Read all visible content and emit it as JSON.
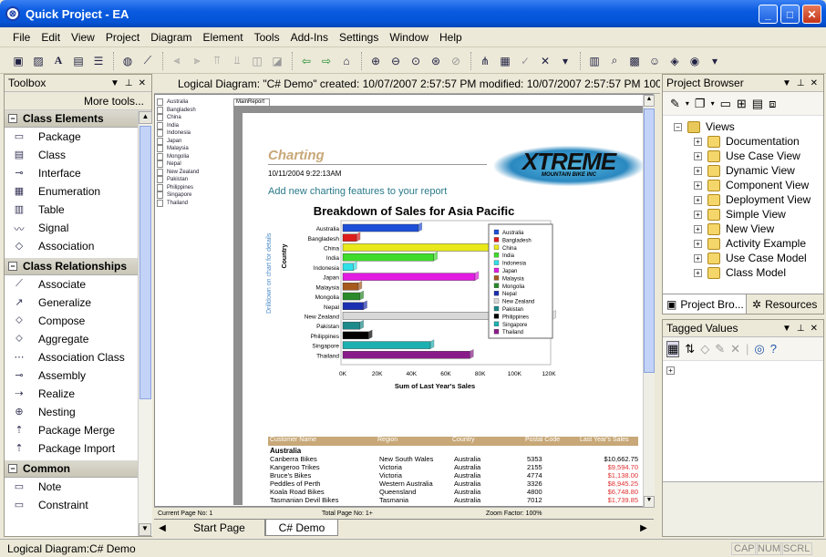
{
  "window": {
    "title": "Quick Project - EA"
  },
  "menu": [
    "File",
    "Edit",
    "View",
    "Project",
    "Diagram",
    "Element",
    "Tools",
    "Add-Ins",
    "Settings",
    "Window",
    "Help"
  ],
  "toolbox": {
    "title": "Toolbox",
    "more": "More tools...",
    "cat1": "Class Elements",
    "items1": [
      "Package",
      "Class",
      "Interface",
      "Enumeration",
      "Table",
      "Signal",
      "Association"
    ],
    "cat2": "Class Relationships",
    "items2": [
      "Associate",
      "Generalize",
      "Compose",
      "Aggregate",
      "Association Class",
      "Assembly",
      "Realize",
      "Nesting",
      "Package Merge",
      "Package Import"
    ],
    "cat3": "Common",
    "items3": [
      "Note",
      "Constraint"
    ]
  },
  "diagram": {
    "header": "Logical Diagram: \"C# Demo\"   created: 10/07/2007 2:57:57 PM  modified: 10/07/2007 2:57:57 PM   100"
  },
  "report": {
    "tab": "MainReport",
    "outline": [
      "Australia",
      "Bangladesh",
      "China",
      "India",
      "Indonesia",
      "Japan",
      "Malaysia",
      "Mongolia",
      "Nepal",
      "New Zealand",
      "Pakistan",
      "Philippines",
      "Singapore",
      "Thailand"
    ],
    "heading": "Charting",
    "datetime": "10/11/2004   9:22:13AM",
    "subheading": "Add new charting features to your report",
    "logo_main": "XTREME",
    "logo_sub": "MOUNTAIN BIKE INC",
    "side_label": "Drilldown on chart for details",
    "table_headers": [
      "Customer Name",
      "Region",
      "Country",
      "Postal Code",
      "Last Year's Sales"
    ],
    "group": "Australia",
    "rows": [
      [
        "Canberra Bikes",
        "New South Wales",
        "Australia",
        "5353",
        "$10,662.75"
      ],
      [
        "Kangeroo Trikes",
        "Victoria",
        "Australia",
        "2155",
        "$9,594.70"
      ],
      [
        "Bruce's Bikes",
        "Victoria",
        "Australia",
        "4774",
        "$1,138.00"
      ],
      [
        "Peddles of Perth",
        "Western Australia",
        "Australia",
        "3326",
        "$8,945.25"
      ],
      [
        "Koala Road Bikes",
        "Queensland",
        "Australia",
        "4800",
        "$6,748.80"
      ],
      [
        "Tasmanian Devil Bikes",
        "Tasmania",
        "Australia",
        "7012",
        "$1,739.85"
      ]
    ],
    "row_colors": [
      "#000000",
      "#e03030",
      "#e03030",
      "#e03030",
      "#e03030",
      "#e03030"
    ],
    "status": {
      "page": "Current Page No: 1",
      "total": "Total Page No: 1+",
      "zoom": "Zoom Factor: 100%"
    }
  },
  "chart_data": {
    "type": "bar",
    "orientation": "horizontal",
    "title": "Breakdown of Sales for Asia Pacific",
    "xlabel": "Sum of Last Year's Sales",
    "ylabel": "Country",
    "categories": [
      "Australia",
      "Bangladesh",
      "China",
      "India",
      "Indonesia",
      "Japan",
      "Malaysia",
      "Mongolia",
      "Nepal",
      "New Zealand",
      "Pakistan",
      "Philippines",
      "Singapore",
      "Thailand"
    ],
    "values": [
      44000,
      8000,
      90000,
      53000,
      6000,
      77000,
      9000,
      10000,
      12000,
      122000,
      10000,
      15000,
      51000,
      74000
    ],
    "colors": [
      "#1d4fd8",
      "#dd1c1c",
      "#e8e81a",
      "#3fdc2c",
      "#30e0e6",
      "#e21ce0",
      "#a65a1c",
      "#2a8a2a",
      "#1c2fb0",
      "#d8d8d8",
      "#1c8a8a",
      "#000000",
      "#1cb0b0",
      "#8a1c8a"
    ],
    "xticks": [
      "0K",
      "20K",
      "40K",
      "60K",
      "80K",
      "100K",
      "120K"
    ],
    "xlim": [
      0,
      120000
    ],
    "legend": "right",
    "grid": false
  },
  "tabs": {
    "start": "Start Page",
    "demo": "C# Demo"
  },
  "browser": {
    "title": "Project Browser",
    "root": "Views",
    "items": [
      "Documentation",
      "Use Case View",
      "Dynamic View",
      "Component View",
      "Deployment View",
      "Simple View",
      "New View",
      "Activity Example",
      "Use Case Model",
      "Class Model"
    ],
    "tab1": "Project Bro...",
    "tab2": "Resources"
  },
  "tagged": {
    "title": "Tagged Values"
  },
  "status": {
    "text": "Logical Diagram:C# Demo",
    "cap": "CAP",
    "num": "NUM",
    "scrl": "SCRL"
  }
}
